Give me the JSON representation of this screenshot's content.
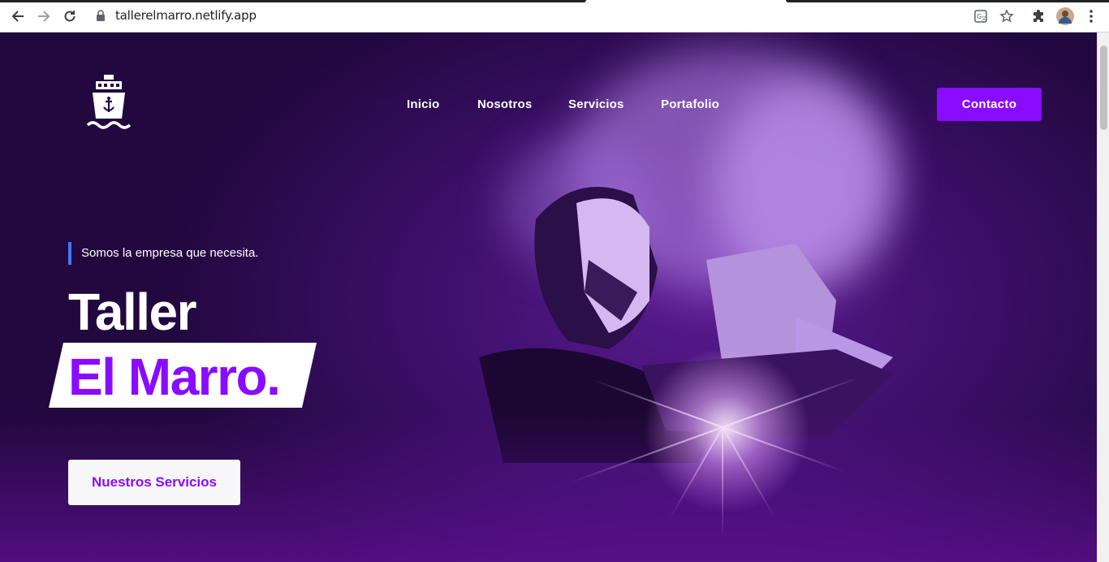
{
  "browser": {
    "url": "tallerelmarro.netlify.app",
    "icons": [
      "back-icon",
      "forward-icon",
      "reload-icon",
      "lock-icon",
      "translate-icon",
      "bookmark-star-icon",
      "extensions-icon",
      "profile-avatar",
      "menu-icon"
    ]
  },
  "header": {
    "logo_icon": "ship-icon",
    "nav": [
      "Inicio",
      "Nosotros",
      "Servicios",
      "Portafolio"
    ],
    "contact_label": "Contacto"
  },
  "hero": {
    "tagline": "Somos la empresa que necesita.",
    "title_line1": "Taller",
    "title_line2": "El Marro.",
    "cta_label": "Nuestros Servicios"
  },
  "colors": {
    "accent": "#8a0cff",
    "background": "#230846",
    "tagline_bar": "#3d7cff"
  }
}
